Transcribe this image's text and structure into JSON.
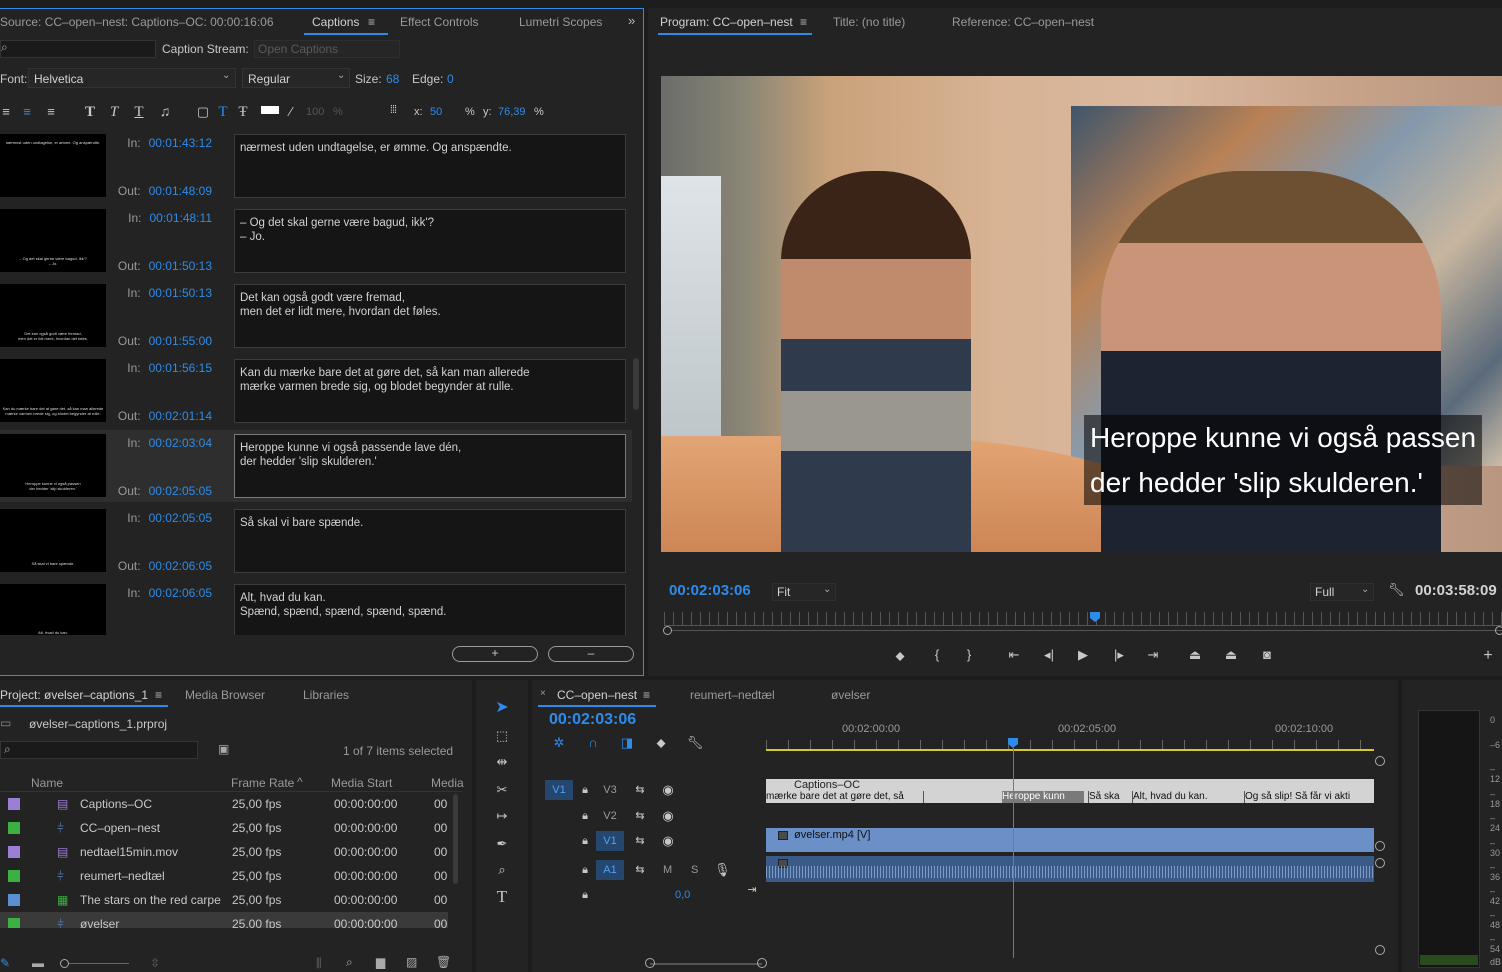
{
  "source_panel": {
    "tabs": [
      "Source: CC–open–nest: Captions–OC: 00:00:16:06",
      "Captions",
      "Effect Controls",
      "Lumetri Scopes"
    ],
    "caption_stream_label": "Caption Stream:",
    "caption_stream_value": "Open Captions",
    "font_label": "Font:",
    "font_value": "Helvetica",
    "style_value": "Regular",
    "size_label": "Size:",
    "size_value": "68",
    "edge_label": "Edge:",
    "edge_value": "0",
    "opacity_value": "100",
    "opacity_unit": "%",
    "x_label": "x:",
    "x_value": "50",
    "x_unit": "%",
    "y_label": "y:",
    "y_value": "76,39",
    "y_unit": "%",
    "in_label": "In:",
    "out_label": "Out:",
    "captions": [
      {
        "in": "00:01:43:12",
        "out": "00:01:48:09",
        "text": "nærmest uden undtagelse, er ømme. Og anspændte.",
        "thumb": "nærmest uden undtagelse, er ømme. Og anspændte."
      },
      {
        "in": "00:01:48:11",
        "out": "00:01:50:13",
        "text": "– Og det skal gerne være bagud, ikk'?\n– Jo.",
        "thumb": "– Og det skal gerne være bagud, ikk'?\n– Jo."
      },
      {
        "in": "00:01:50:13",
        "out": "00:01:55:00",
        "text": "Det kan også godt være fremad,\nmen det er lidt mere, hvordan det føles.",
        "thumb": "Det kan også godt være fremad,\nmen det er lidt mere, hvordan det føles."
      },
      {
        "in": "00:01:56:15",
        "out": "00:02:01:14",
        "text": "Kan du mærke bare det at gøre det, så kan man allerede\nmærke varmen brede sig, og blodet begynder at rulle.",
        "thumb": "Kan du mærke bare det at gøre det, så kan man allerede\nmærke varmen brede sig, og blodet begynder at rulle."
      },
      {
        "in": "00:02:03:04",
        "out": "00:02:05:05",
        "text": "Heroppe kunne vi også passende lave dén,\nder hedder 'slip skulderen.'",
        "thumb": "Heroppe kunne vi også passen\nder hedder 'slip skulderen.'"
      },
      {
        "in": "00:02:05:05",
        "out": "00:02:06:05",
        "text": "Så skal vi bare spænde.",
        "thumb": "Så skal vi bare spænde."
      },
      {
        "in": "00:02:06:05",
        "out": "",
        "text": "Alt, hvad du kan.\nSpænd, spænd, spænd, spænd, spænd.",
        "thumb": "Alt, hvad du kan."
      }
    ],
    "add_label": "+",
    "remove_label": "–"
  },
  "program_panel": {
    "tabs": [
      "Program: CC–open–nest",
      "Title: (no title)",
      "Reference: CC–open–nest"
    ],
    "overlay_line1": "Heroppe kunne vi også passen",
    "overlay_line2": "der hedder 'slip skulderen.'",
    "timecode": "00:02:03:06",
    "fit_value": "Fit",
    "quality_value": "Full",
    "duration": "00:03:58:09"
  },
  "project_panel": {
    "tabs": [
      "Project: øvelser–captions_1",
      "Media Browser",
      "Libraries"
    ],
    "project_file": "øvelser–captions_1.prproj",
    "selection_info": "1 of 7 items selected",
    "columns": [
      "Name",
      "Frame Rate",
      "Media Start",
      "Media"
    ],
    "items": [
      {
        "name": "Captions–OC",
        "rate": "25,00 fps",
        "start": "00:00:00:00",
        "media": "00",
        "color": "#9b7fd4"
      },
      {
        "name": "CC–open–nest",
        "rate": "25,00 fps",
        "start": "00:00:00:00",
        "media": "00",
        "color": "#3cb043"
      },
      {
        "name": "nedtael15min.mov",
        "rate": "25,00 fps",
        "start": "00:00:00:00",
        "media": "00",
        "color": "#9b7fd4"
      },
      {
        "name": "reumert–nedtæl",
        "rate": "25,00 fps",
        "start": "00:00:00:00",
        "media": "00",
        "color": "#3cb043"
      },
      {
        "name": "The stars on the red carpe",
        "rate": "25,00 fps",
        "start": "00:00:00:00",
        "media": "00",
        "color": "#5b8fd4"
      },
      {
        "name": "øvelser",
        "rate": "25,00 fps",
        "start": "00:00:00:00",
        "media": "00",
        "color": "#3cb043"
      }
    ]
  },
  "timeline": {
    "tabs": [
      "CC–open–nest",
      "reumert–nedtæl",
      "øvelser"
    ],
    "timecode": "00:02:03:06",
    "ruler": [
      "00:02:00:00",
      "00:02:05:00",
      "00:02:10:00"
    ],
    "tracks": [
      "V3",
      "V2",
      "V1",
      "A1"
    ],
    "caption_clip_name": "Captions–OC",
    "caption_segments": [
      "mærke bare det at gøre det, så",
      "Heroppe kunn",
      "Så ska",
      "Alt, hvad du kan.",
      "Og så slip! Så får vi akti"
    ],
    "video_clip_name": "øvelser.mp4 [V]",
    "audio_m": "M",
    "audio_s": "S",
    "master_value": "0,0"
  },
  "meter": {
    "labels": [
      "0",
      "–6",
      "–12",
      "–18",
      "–24",
      "–30",
      "–36",
      "–42",
      "–48",
      "–54",
      "dB"
    ]
  }
}
